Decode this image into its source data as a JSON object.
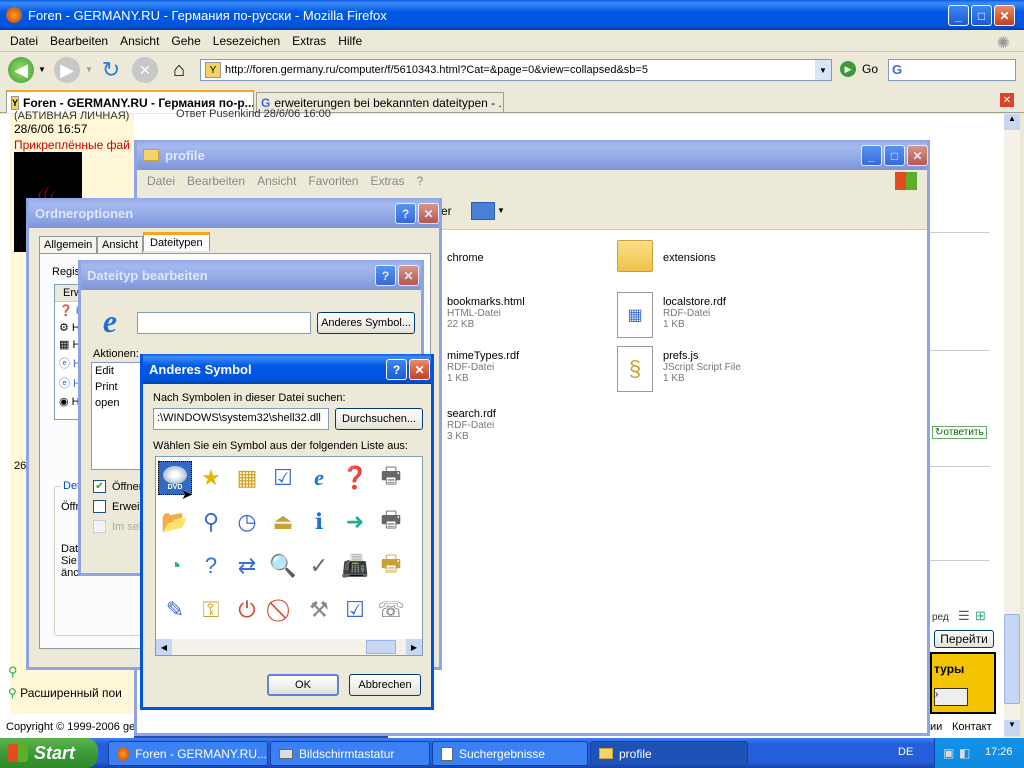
{
  "firefox": {
    "title": "Foren - GERMANY.RU - Германия по-русски - Mozilla Firefox",
    "menu": [
      "Datei",
      "Bearbeiten",
      "Ansicht",
      "Gehe",
      "Lesezeichen",
      "Extras",
      "Hilfe"
    ],
    "url": "http://foren.germany.ru/computer/f/5610343.html?Cat=&page=0&view=collapsed&sb=5",
    "go_label": "Go",
    "tabs": [
      "Foren - GERMANY.RU - Германия по-р...",
      "erweiterungen bei bekannten dateitypen - ..."
    ],
    "page": {
      "user_line": "(АБТИВНАЯ ЛИЧНАЯ)",
      "date": "28/6/06 16:57",
      "attached": "Прикреплённые фай",
      "post_header": "Ответ Pusenkind 28/6/06 16:00",
      "reply_label": "ответить",
      "ext_label": "Расширенный пои",
      "copyright": "Copyright © 1999-2006 ge",
      "footer_link1": "ии",
      "footer_link2": "Контакт",
      "goto_button": "Перейти",
      "ad_text": "туры",
      "small_red": "ред",
      "year_fragment": "26"
    }
  },
  "explorer": {
    "title": "profile",
    "menu": [
      "Datei",
      "Bearbeiten",
      "Ansicht",
      "Favoriten",
      "Extras",
      "?"
    ],
    "toolbar_er": "er",
    "files": [
      {
        "name": "chrome",
        "type": "",
        "size": ""
      },
      {
        "name": "extensions",
        "type": "",
        "size": ""
      },
      {
        "name": "bookmarks.html",
        "type": "HTML-Datei",
        "size": "22 KB"
      },
      {
        "name": "localstore.rdf",
        "type": "RDF-Datei",
        "size": "1 KB"
      },
      {
        "name": "mimeTypes.rdf",
        "type": "RDF-Datei",
        "size": "1 KB"
      },
      {
        "name": "prefs.js",
        "type": "JScript Script File",
        "size": "1 KB"
      },
      {
        "name": "search.rdf",
        "type": "RDF-Datei",
        "size": "3 KB"
      }
    ]
  },
  "ordneroptionen": {
    "title": "Ordneroptionen",
    "tabs": [
      "Allgemein",
      "Ansicht",
      "Dateitypen"
    ],
    "regis_label": "Regis",
    "list_header": "Erw",
    "det_label": "Det",
    "offnen_label": "Öffr",
    "bottom_text": [
      "Dat",
      "Sie",
      "änc"
    ]
  },
  "dateityp": {
    "title": "Dateityp bearbeiten",
    "icon_button": "Anderes Symbol...",
    "actions_label": "Aktionen:",
    "actions": [
      "Edit",
      "Print",
      "open"
    ],
    "checkboxes": [
      {
        "label": "Öffnen",
        "checked": true
      },
      {
        "label": "Erweit",
        "checked": false
      },
      {
        "label": "Im sel",
        "checked": false
      }
    ]
  },
  "symbol": {
    "title": "Anderes Symbol",
    "search_label": "Nach Symbolen in dieser Datei suchen:",
    "file_path": ":\\WINDOWS\\system32\\shell32.dll",
    "browse_button": "Durchsuchen...",
    "choose_label": "Wählen Sie ein Symbol aus der folgenden Liste aus:",
    "dvd_label": "DVD",
    "ok": "OK",
    "cancel": "Abbrechen"
  },
  "taskbar": {
    "start": "Start",
    "items": [
      "Foren - GERMANY.RU...",
      "Bildschirmtastatur",
      "Suchergebnisse",
      "profile"
    ],
    "lang": "DE",
    "time": "17:26"
  },
  "colors": {
    "xp_blue": "#0054e3",
    "taskbar": "#245edb",
    "start_green": "#3c9a37"
  }
}
